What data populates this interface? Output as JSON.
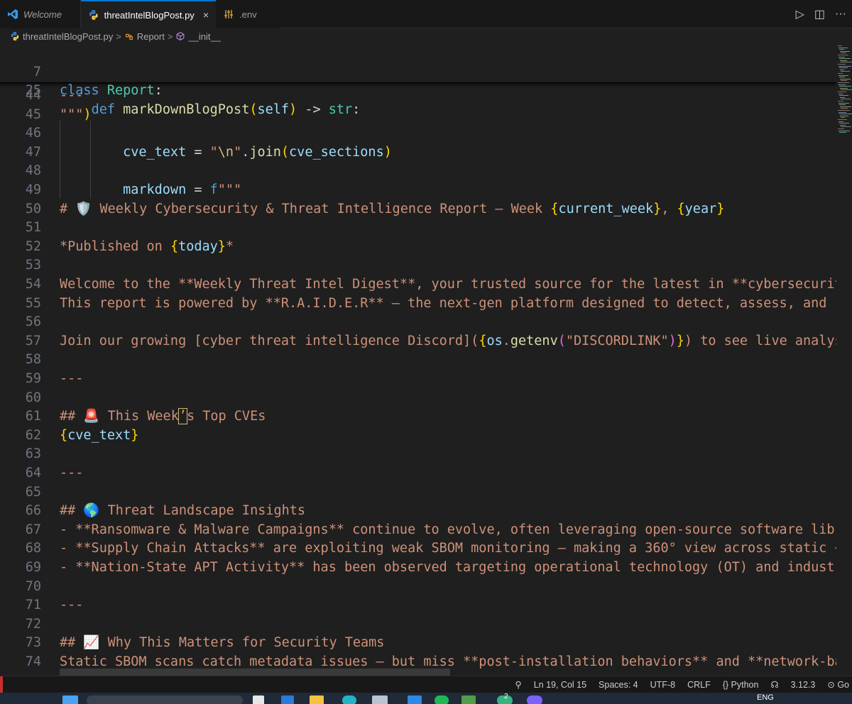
{
  "tabs": [
    {
      "label": "Welcome",
      "icon": "vscode-icon",
      "active": false
    },
    {
      "label": "threatIntelBlogPost.py",
      "icon": "python-icon",
      "active": true,
      "close": "×"
    },
    {
      "label": ".env",
      "icon": "settings-file-icon",
      "active": false
    }
  ],
  "toolbar": {
    "run": "▷",
    "split": "◫",
    "more": "···"
  },
  "breadcrumb": {
    "file": "threatIntelBlogPost.py",
    "class": "Report",
    "member": "__init__",
    "sep": ">"
  },
  "sticky": [
    {
      "n": "7",
      "text": "class Report:"
    },
    {
      "n": "25",
      "text": "    def markDownBlogPost(self) -> str:"
    }
  ],
  "lines": [
    {
      "n": "44",
      "text": "---"
    },
    {
      "n": "45",
      "text": "\"\"\")"
    },
    {
      "n": "46",
      "text": ""
    },
    {
      "n": "47",
      "text": "        cve_text = \"\\n\".join(cve_sections)"
    },
    {
      "n": "48",
      "text": ""
    },
    {
      "n": "49",
      "text": "        markdown = f\"\"\""
    },
    {
      "n": "50",
      "text": "# 🛡️ Weekly Cybersecurity & Threat Intelligence Report — Week {current_week}, {year}"
    },
    {
      "n": "51",
      "text": ""
    },
    {
      "n": "52",
      "text": "*Published on {today}*"
    },
    {
      "n": "53",
      "text": ""
    },
    {
      "n": "54",
      "text": "Welcome to the **Weekly Threat Intel Digest**, your trusted source for the latest in **cybersecurity"
    },
    {
      "n": "55",
      "text": "This report is powered by **R.A.I.D.E.R** — the next-gen platform designed to detect, assess, and rep"
    },
    {
      "n": "56",
      "text": ""
    },
    {
      "n": "57",
      "text": "Join our growing [cyber threat intelligence Discord]({os.getenv(\"DISCORDLINK\")}) to see live analysis"
    },
    {
      "n": "58",
      "text": ""
    },
    {
      "n": "59",
      "text": "---"
    },
    {
      "n": "60",
      "text": ""
    },
    {
      "n": "61",
      "text": "## 🚨 This Week’s Top CVEs"
    },
    {
      "n": "62",
      "text": "{cve_text}"
    },
    {
      "n": "63",
      "text": ""
    },
    {
      "n": "64",
      "text": "---"
    },
    {
      "n": "65",
      "text": ""
    },
    {
      "n": "66",
      "text": "## 🌎 Threat Landscape Insights"
    },
    {
      "n": "67",
      "text": "- **Ransomware & Malware Campaigns** continue to evolve, often leveraging open-source software librar"
    },
    {
      "n": "68",
      "text": "- **Supply Chain Attacks** are exploiting weak SBOM monitoring — making a 360° view across static + d"
    },
    {
      "n": "69",
      "text": "- **Nation-State APT Activity** has been observed targeting operational technology (OT) and industria"
    },
    {
      "n": "70",
      "text": ""
    },
    {
      "n": "71",
      "text": "---"
    },
    {
      "n": "72",
      "text": ""
    },
    {
      "n": "73",
      "text": "## 📈 Why This Matters for Security Teams"
    },
    {
      "n": "74",
      "text": "Static SBOM scans catch metadata issues — but miss **post-installation behaviors** and **network-base"
    }
  ],
  "status": {
    "position": "Ln 19, Col 15",
    "spaces": "Spaces: 4",
    "encoding": "UTF-8",
    "eol": "CRLF",
    "language": "{} Python",
    "python_version": "3.12.3",
    "golive": "Go"
  },
  "taskbar": {
    "lang": "ENG",
    "badge": "2"
  },
  "colors": {
    "editor_bg": "#1f1f1f",
    "tab_accent": "#0078d4",
    "keyword": "#569cd6",
    "class": "#4ec9b0",
    "function": "#dcdcaa",
    "variable": "#9cdcfe",
    "string": "#ce9178",
    "bracket1": "#ffd700",
    "bracket2": "#da70d6",
    "bracket3": "#179fff",
    "line_number": "#6e7681"
  }
}
